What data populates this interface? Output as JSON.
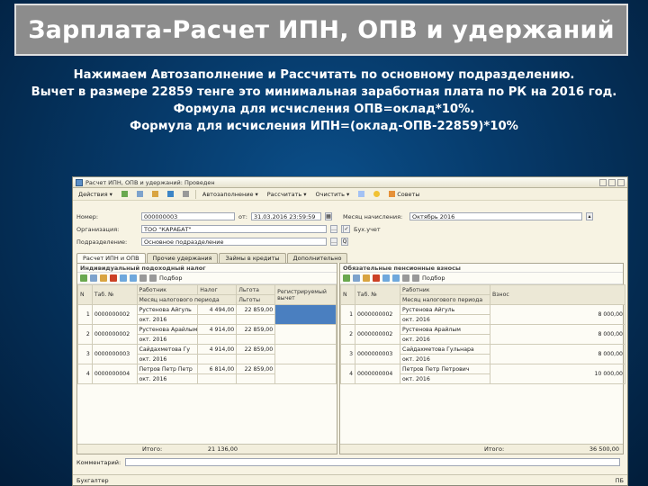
{
  "slide": {
    "title": "Зарплата-Расчет ИПН, ОПВ и удержаний",
    "lines": [
      "Нажимаем Автозаполнение и Рассчитать по основному подразделению.",
      "Вычет в размере 22859 тенге это минимальная заработная плата по РК на 2016 год.",
      "Формула для исчисления ОПВ=оклад*10%.",
      "Формула для исчисления ИПН=(оклад-ОПВ-22859)*10%"
    ]
  },
  "window": {
    "title": "Расчет ИПН, ОПВ и удержаний: Проведен",
    "toolbar": [
      "Действия",
      "Автозаполнение",
      "Рассчитать",
      "Очистить",
      "Советы"
    ],
    "fields": {
      "number_label": "Номер:",
      "number_value": "000000003",
      "date_label": "от:",
      "date_value": "31.03.2016 23:59:59",
      "month_label": "Месяц начисления:",
      "month_value": "Октябрь 2016",
      "org_label": "Организация:",
      "org_value": "ТОО \"КАРАБАТ\"",
      "subdiv_label": "Подразделение:",
      "subdiv_value": "Основное подразделение",
      "buh_label": "Бух.учет"
    },
    "tabs": [
      "Расчет ИПН и ОПВ",
      "Прочие удержания",
      "Займы в кредиты",
      "Дополнительно"
    ],
    "left_panel": {
      "title": "Индивидуальный подоходный налог",
      "columns": [
        "N",
        "Таб. №",
        "Работник",
        "Налог",
        "Льгота",
        "Регистрируемый вычет"
      ],
      "sub": "Месяц налогового периода",
      "sub2": "Льготы",
      "tools": [
        "Подбор"
      ],
      "rows": [
        {
          "n": "1",
          "tab": "0000000002",
          "name": "Рустенова Айгуль",
          "m": "окт. 2016",
          "tax": "4 494,00",
          "v": "22 859,00"
        },
        {
          "n": "2",
          "tab": "0000000002",
          "name": "Рустенова Арайлым",
          "m": "окт. 2016",
          "tax": "4 914,00",
          "v": "22 859,00"
        },
        {
          "n": "3",
          "tab": "0000000003",
          "name": "Сайдахметова Гу",
          "m": "окт. 2016",
          "tax": "4 914,00",
          "v": "22 859,00"
        },
        {
          "n": "4",
          "tab": "0000000004",
          "name": "Петров Петр Петр",
          "m": "окт. 2016",
          "tax": "6 814,00",
          "v": "22 859,00"
        }
      ],
      "total_label": "Итого:",
      "total": "21 136,00"
    },
    "right_panel": {
      "title": "Обязательные пенсионные взносы",
      "columns": [
        "N",
        "Таб. №",
        "Работник",
        "Взнос"
      ],
      "sub": "Месяц налогового периода",
      "tools": [
        "Подбор"
      ],
      "rows": [
        {
          "n": "1",
          "tab": "0000000002",
          "name": "Рустенова Айгуль",
          "m": "окт. 2016",
          "v": "8 000,00"
        },
        {
          "n": "2",
          "tab": "0000000002",
          "name": "Рустенова Арайлым",
          "m": "окт. 2016",
          "v": "8 000,00"
        },
        {
          "n": "3",
          "tab": "0000000003",
          "name": "Сайдахметова Гульнара",
          "m": "окт. 2016",
          "v": "8 000,00"
        },
        {
          "n": "4",
          "tab": "0000000004",
          "name": "Петров Петр Петрович",
          "m": "окт. 2016",
          "v": "10 000,00"
        }
      ],
      "total_label": "Итого:",
      "total": "36 500,00"
    },
    "comment_label": "Комментарий:",
    "status_left": "Бухгалтер",
    "status_right": "ПБ"
  }
}
